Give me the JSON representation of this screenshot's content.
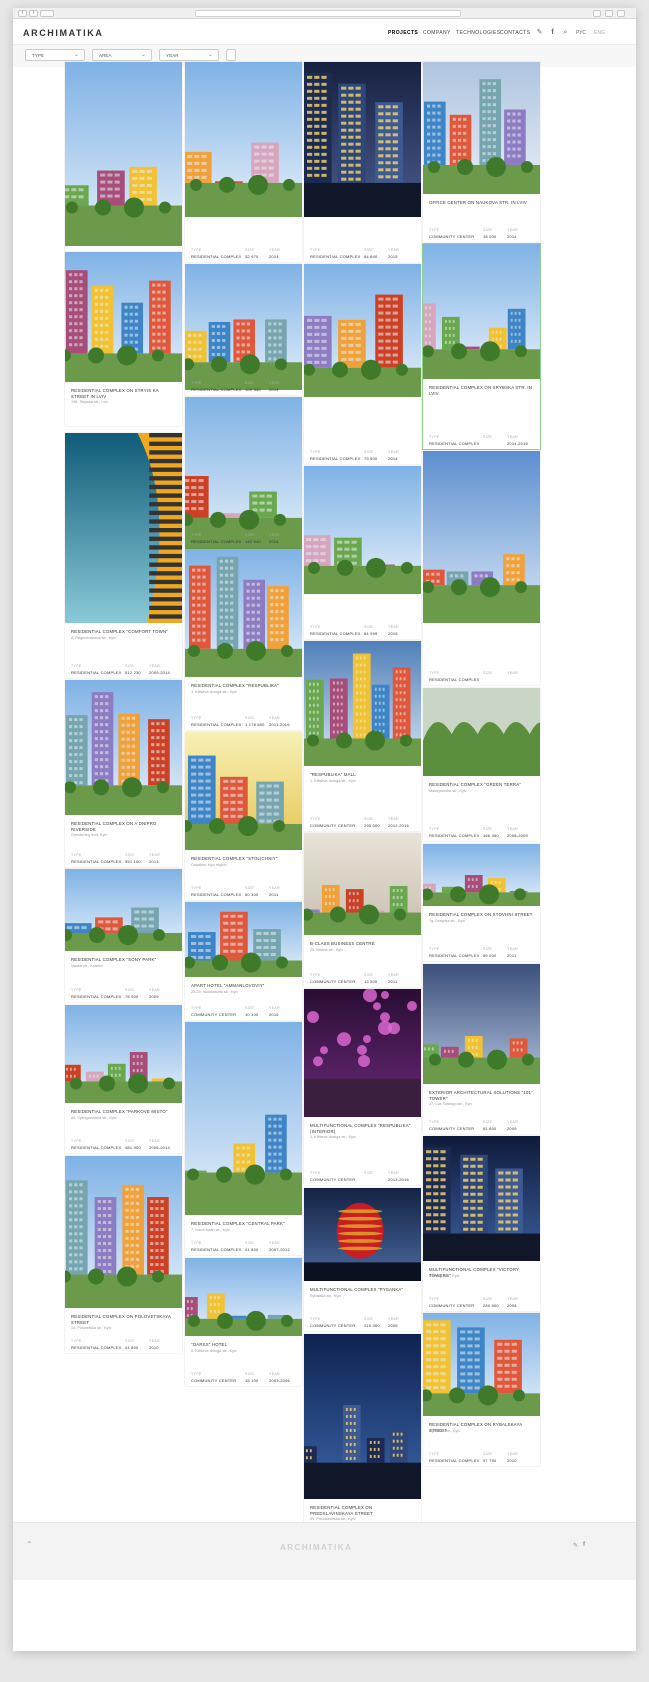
{
  "brand": {
    "logo": "ARCHIMATIKA",
    "footer_logo": "ARCHIMATIKA"
  },
  "nav": [
    {
      "label": "PROJECTS",
      "active": true
    },
    {
      "label": "COMPANY",
      "active": false
    },
    {
      "label": "TECHNOLOGIES",
      "active": false
    },
    {
      "label": "CONTACTS",
      "active": false
    }
  ],
  "header_icons": [
    "pen-icon",
    "facebook-icon",
    "search-icon"
  ],
  "languages": [
    {
      "label": "РУС",
      "active": true
    },
    {
      "label": "ENG",
      "active": false
    }
  ],
  "filters": [
    {
      "label": "TYPE"
    },
    {
      "label": "AREA"
    },
    {
      "label": "YEAR"
    }
  ],
  "meta_labels": {
    "type": "TYPE",
    "size": "SIZE",
    "year": "YEAR"
  },
  "colors": {
    "accent_green": "#8fcf8f",
    "text": "#222222",
    "background": "#e7e7e7"
  },
  "projects": [
    {
      "col": 0,
      "title": "",
      "address": "",
      "type": "",
      "size": "",
      "year": "",
      "scene": "tower-teal"
    },
    {
      "col": 0,
      "title": "RESIDENTIAL COMPLEX ON STRYIS KA STREET IN LVIV",
      "address": "196, Stryiska str., Lviv",
      "type": "",
      "size": "",
      "year": "",
      "scene": "courtyard"
    },
    {
      "col": 0,
      "title": "RESIDENTIAL COMPLEX \"COMFORT TOWN\"",
      "address": "6, Regeneratorna str., Kyiv",
      "type": "RESIDENTIAL COMPLEX",
      "size": "512 230",
      "year": "2009-2014",
      "scene": "sky-facade"
    },
    {
      "col": 0,
      "title": "RESIDENTIAL COMPLEX ON A DNIPRO RIVERSIDE",
      "address": "Gerbachiny fruit, Kyiv",
      "type": "RESIDENTIAL COMPLEX",
      "size": "351 100",
      "year": "2013",
      "scene": "round-towers"
    },
    {
      "col": 0,
      "title": "RESIDENTIAL COMPLEX \"SONY PARK\"",
      "address": "Nauka str., Kharkiv",
      "type": "RESIDENTIAL COMPLEX",
      "size": "78 900",
      "year": "2009",
      "scene": "terraces"
    },
    {
      "col": 0,
      "title": "RESIDENTIAL COMPLEX \"PARKOVE MISTO\"",
      "address": "65, Vyshgorodska str., Kyiv",
      "type": "RESIDENTIAL COMPLEX",
      "size": "481 900",
      "year": "2006-2014",
      "scene": "curved-blocks"
    },
    {
      "col": 0,
      "title": "RESIDENTIAL COMPLEX ON POLOVETSKAYA STREET",
      "address": "14, Polovetska str., Kyiv",
      "type": "RESIDENTIAL COMPLEX",
      "size": "41 800",
      "year": "2010",
      "scene": "yellow-towers"
    },
    {
      "col": 1,
      "title": "",
      "address": "",
      "type": "RESIDENTIAL COMPLEX",
      "size": "32 970",
      "year": "2014",
      "scene": "colorful-blocks"
    },
    {
      "col": 1,
      "title": "",
      "address": "",
      "type": "RESIDENTIAL COMPLEX",
      "size": "109 340",
      "year": "2014",
      "scene": "colorful-street"
    },
    {
      "col": 1,
      "title": "",
      "address": "",
      "type": "RESIDENTIAL COMPLEX",
      "size": "142 940",
      "year": "2014",
      "scene": "park-green"
    },
    {
      "col": 1,
      "title": "RESIDENTIAL COMPLEX \"RESPUBLIKA\"",
      "address": "1, Kiltseva doroga str., Kyiv",
      "type": "RESIDENTIAL COMPLEX",
      "size": "1 178 800",
      "year": "2011-2016",
      "scene": "rainbow"
    },
    {
      "col": 1,
      "title": "RESIDENTIAL COMPLEX \"STOLICHNIY\"",
      "address": "Osadkev, Kyiv region",
      "type": "RESIDENTIAL COMPLEX",
      "size": "60 300",
      "year": "2011",
      "scene": "sunny"
    },
    {
      "col": 1,
      "title": "APART HOTEL \"AMMANLOVOVIY\"",
      "address": "25-29, Vodoplavna str., Kyiv",
      "type": "COMMUNITY CENTER",
      "size": "10 100",
      "year": "2015",
      "scene": "apart-hotel"
    },
    {
      "col": 1,
      "title": "RESIDENTIAL COMPLEX \"CENTRAL PARK\"",
      "address": "7, Ivana Kudri str., Kyiv",
      "type": "RESIDENTIAL COMPLEX",
      "size": "41 800",
      "year": "2007-2012",
      "scene": "aerial"
    },
    {
      "col": 1,
      "title": "\"OARSS\" HOTEL",
      "address": "6, Kiltseva doroga str., Kyiv",
      "type": "COMMUNITY CENTER",
      "size": "15 100",
      "year": "2003-2006",
      "scene": "terrace-hotel"
    },
    {
      "col": 2,
      "title": "",
      "address": "",
      "type": "RESIDENTIAL COMPLEX",
      "size": "84 840",
      "year": "2015",
      "scene": "night-tower"
    },
    {
      "col": 2,
      "title": "",
      "address": "",
      "type": "RESIDENTIAL COMPLEX",
      "size": "79 500",
      "year": "2014",
      "scene": "street-colorful"
    },
    {
      "col": 2,
      "title": "",
      "address": "",
      "type": "RESIDENTIAL COMPLEX",
      "size": "64 999",
      "year": "2015",
      "scene": "aerial-blocks"
    },
    {
      "col": 2,
      "title": "\"RESPUBLIKA\" MALL",
      "address": "1, Kiltseva doroga str., Kyiv",
      "type": "COMMUNITY CENTER",
      "size": "295 000",
      "year": "2012-2016",
      "scene": "mall"
    },
    {
      "col": 2,
      "title": "B-CLASS BUSINESS CENTRE",
      "address": "25, Bruma str., Kyiv",
      "type": "COMMUNITY CENTER",
      "size": "13 500",
      "year": "2011",
      "scene": "business"
    },
    {
      "col": 2,
      "title": "MULTIFUNCTIONAL COMPLEX \"RESPUBLIKA\" (INTERIOR)",
      "address": "1, Kiltseva doroga str., Kyiv",
      "type": "COMMUNITY CENTER",
      "size": "",
      "year": "2013-2016",
      "scene": "interior"
    },
    {
      "col": 2,
      "title": "MULTIFUNCTIONAL COMPLEX \"PYSANKA\"",
      "address": "Rybalska str., Kyiv",
      "type": "COMMUNITY CENTER",
      "size": "210 000",
      "year": "2005",
      "scene": "egg"
    },
    {
      "col": 2,
      "title": "RESIDENTIAL COMPLEX ON PREDSLAVINSKAYA STREET",
      "address": "59, Predslavinska str., Kyiv",
      "type": "RESIDENTIAL COMPLEX",
      "size": "48 500",
      "year": "2011",
      "scene": "twin-towers"
    },
    {
      "col": 3,
      "title": "OFFICE CENTER ON NAUKOVA STR. IN LVIV",
      "address": "",
      "type": "COMMUNITY CENTER",
      "size": "18 000",
      "year": "2014",
      "scene": "office-purple"
    },
    {
      "col": 3,
      "title": "RESIDENTIAL COMPLEX ON SRYBSKA STR. IN LVIV",
      "address": "",
      "type": "RESIDENTIAL COMPLEX",
      "size": "",
      "year": "2014-2015",
      "scene": "lviv-block"
    },
    {
      "col": 3,
      "title": "",
      "address": "",
      "type": "RESIDENTIAL COMPLEX",
      "size": "",
      "year": "",
      "scene": "blue-tower"
    },
    {
      "col": 3,
      "title": "RESIDENTIAL COMPLEX \"GREEN TERRA\"",
      "address": "Maksymovka str., Kyiv",
      "type": "RESIDENTIAL COMPLEX",
      "size": "166 450",
      "year": "2008-2009",
      "scene": "green-roofs"
    },
    {
      "col": 3,
      "title": "RESIDENTIAL COMPLEX ON STOVHNI STREET",
      "address": "7g, Drayhka str., Kyiv",
      "type": "RESIDENTIAL COMPLEX",
      "size": "89 000",
      "year": "2011",
      "scene": "stovhni"
    },
    {
      "col": 3,
      "title": "EXTERIOR ARCHITECTURAL SOLUTIONS \"101\" TOWER\"",
      "address": "37, Lva Tolstogo str., Kyiv",
      "type": "COMMUNITY CENTER",
      "size": "61 800",
      "year": "2009",
      "scene": "glass-tower"
    },
    {
      "col": 3,
      "title": "MULTIFUNCTIONAL COMPLEX \"VICTORY TOWERS\"",
      "address": "Pobedy ave., Kyiv",
      "type": "COMMUNITY CENTER",
      "size": "280 900",
      "year": "2008",
      "scene": "victory"
    },
    {
      "col": 3,
      "title": "RESIDENTIAL COMPLEX ON RYBALSKAYA STREET",
      "address": "Rybalska str., Kyiv",
      "type": "RESIDENTIAL COMPLEX",
      "size": "97 750",
      "year": "2010",
      "scene": "green-towers"
    }
  ]
}
